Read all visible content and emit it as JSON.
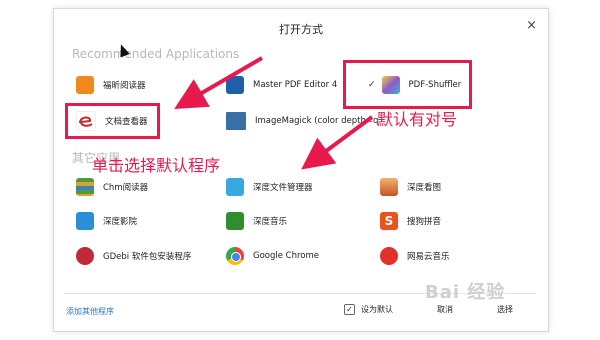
{
  "dialog": {
    "title": "打开方式",
    "close_glyph": "×",
    "sections": {
      "recommended": "Recommended Applications",
      "other": "其它应用"
    },
    "recommended_apps": [
      {
        "label": "福昕阅读器",
        "icon": "foxit-reader-icon",
        "color": "#f08a1c"
      },
      {
        "label": "Master PDF Editor 4",
        "icon": "master-pdf-icon",
        "color": "#1f5fa8"
      },
      {
        "label": "PDF-Shuffler",
        "icon": "pdf-shuffler-icon",
        "color": "#8e5bc9",
        "selected": true,
        "check": "✓"
      },
      {
        "label": "文档查看器",
        "icon": "document-viewer-icon",
        "color": "#c7282a"
      },
      {
        "label": "ImageMagick (color depth=q",
        "icon": "imagemagick-icon",
        "color": "#3a6fa6"
      }
    ],
    "other_apps": [
      {
        "label": "Chm阅读器",
        "icon": "chm-reader-icon",
        "color": "#4a9d3a"
      },
      {
        "label": "深度文件管理器",
        "icon": "file-manager-icon",
        "color": "#38a8e0"
      },
      {
        "label": "深度看图",
        "icon": "image-viewer-icon",
        "color": "#e8884a"
      },
      {
        "label": "深度影院",
        "icon": "movie-icon",
        "color": "#2b8fd8"
      },
      {
        "label": "深度音乐",
        "icon": "music-icon",
        "color": "#2f8f2f"
      },
      {
        "label": "搜狗拼音",
        "icon": "sogou-icon",
        "color": "#e8541c"
      },
      {
        "label": "GDebi 软件包安装程序",
        "icon": "gdebi-icon",
        "color": "#c02a3a"
      },
      {
        "label": "Google Chrome",
        "icon": "chrome-icon",
        "color": "#4285f4"
      },
      {
        "label": "网易云音乐",
        "icon": "netease-music-icon",
        "color": "#e0312a"
      }
    ],
    "footer": {
      "add_other": "添加其他程序",
      "set_default_label": "设为默认",
      "set_default_check": "✓",
      "cancel": "取消",
      "choose": "选择"
    }
  },
  "annotations": {
    "default_label": "默认有对号",
    "click_hint": "单击选择默认程序",
    "accent_color": "#e8194c"
  },
  "watermark": "Bai 经验"
}
